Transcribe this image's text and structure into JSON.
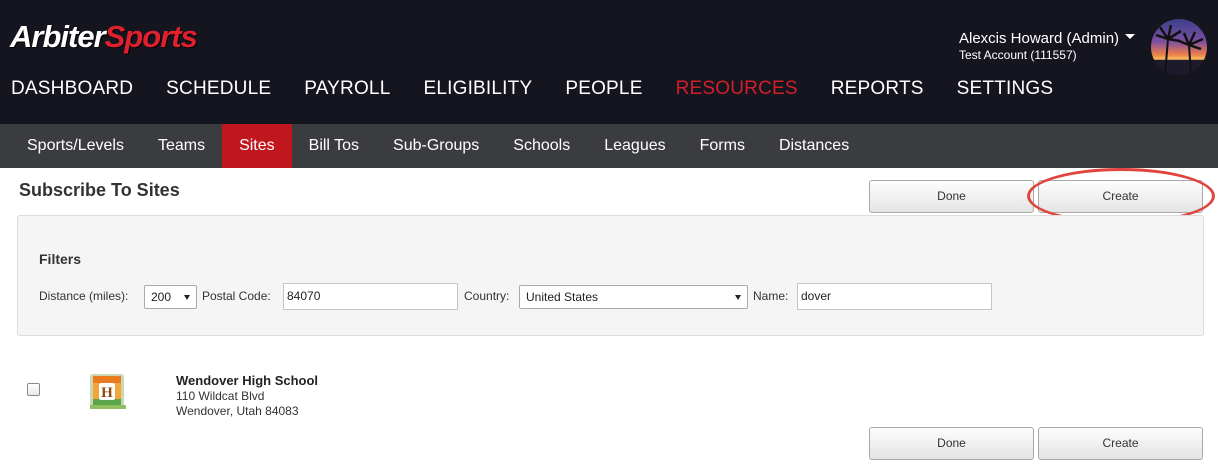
{
  "brand": {
    "part1": "Arbiter",
    "part2": "Sports"
  },
  "user": {
    "name": "Alexcis Howard (Admin)",
    "account": "Test Account (111557)"
  },
  "main_nav": [
    {
      "label": "DASHBOARD"
    },
    {
      "label": "SCHEDULE"
    },
    {
      "label": "PAYROLL"
    },
    {
      "label": "ELIGIBILITY"
    },
    {
      "label": "PEOPLE"
    },
    {
      "label": "RESOURCES",
      "active": true
    },
    {
      "label": "REPORTS"
    },
    {
      "label": "SETTINGS"
    }
  ],
  "sub_nav": [
    {
      "label": "Sports/Levels"
    },
    {
      "label": "Teams"
    },
    {
      "label": "Sites",
      "active": true
    },
    {
      "label": "Bill Tos"
    },
    {
      "label": "Sub-Groups"
    },
    {
      "label": "Schools"
    },
    {
      "label": "Leagues"
    },
    {
      "label": "Forms"
    },
    {
      "label": "Distances"
    }
  ],
  "page": {
    "title": "Subscribe To Sites",
    "done_label": "Done",
    "create_label": "Create"
  },
  "filters": {
    "title": "Filters",
    "distance_label": "Distance (miles):",
    "distance_value": "200",
    "postal_label": "Postal Code:",
    "postal_value": "84070",
    "country_label": "Country:",
    "country_value": "United States",
    "name_label": "Name:",
    "name_value": "dover"
  },
  "results": [
    {
      "name": "Wendover High School",
      "address_line1": "110 Wildcat Blvd",
      "address_line2": "Wendover, Utah 84083",
      "icon": "school-building-icon",
      "checked": false
    }
  ],
  "colors": {
    "header_bg": "#15151f",
    "subnav_bg": "#3b3c3f",
    "accent_red": "#c0171f",
    "nav_active_text": "#d21f2a",
    "highlight_ring": "#e0443d"
  }
}
